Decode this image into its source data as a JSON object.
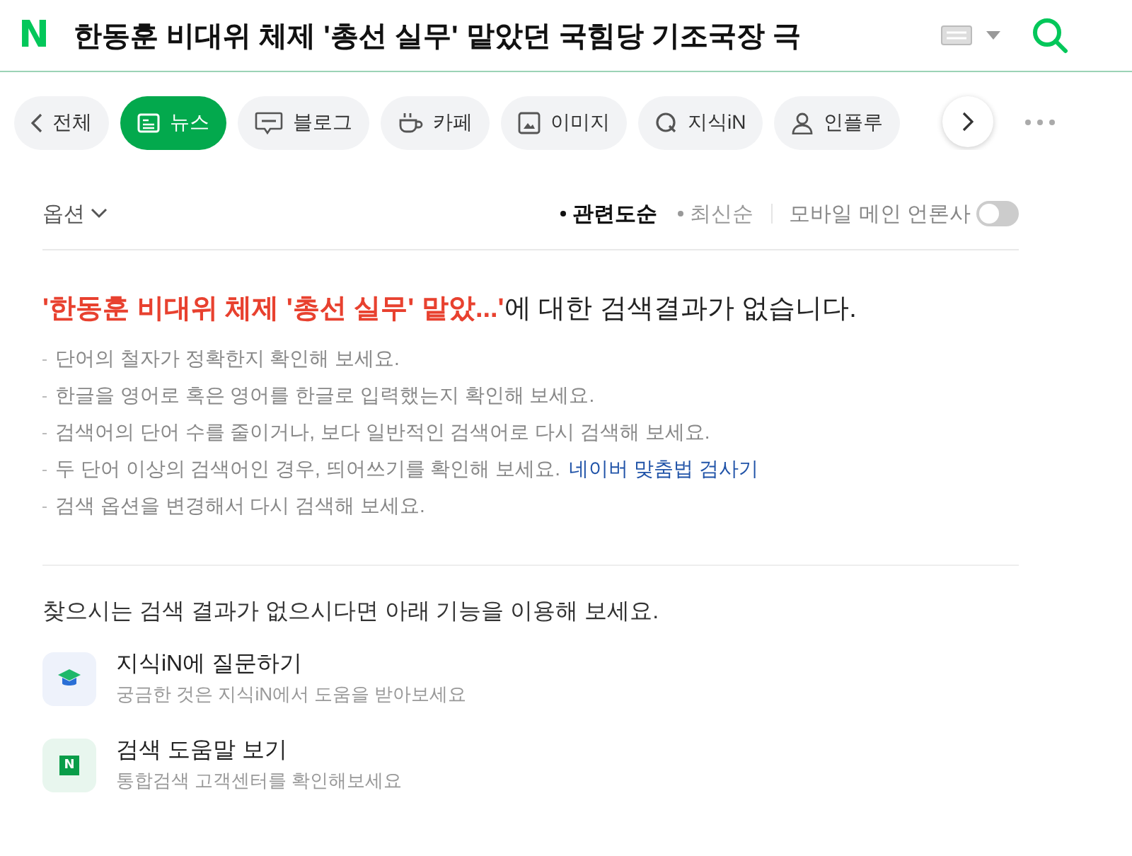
{
  "header": {
    "logo": "N",
    "query": "한동훈 비대위 체제 '총선 실무' 맡았던 국힘당 기조국장 극"
  },
  "tabs": [
    {
      "kind": "back",
      "label": "전체",
      "selected": false
    },
    {
      "kind": "news",
      "label": "뉴스",
      "selected": true
    },
    {
      "kind": "blog",
      "label": "블로그",
      "selected": false
    },
    {
      "kind": "cafe",
      "label": "카페",
      "selected": false
    },
    {
      "kind": "image",
      "label": "이미지",
      "selected": false
    },
    {
      "kind": "kin",
      "label": "지식iN",
      "selected": false
    },
    {
      "kind": "person",
      "label": "인플루",
      "selected": false
    }
  ],
  "options": {
    "label": "옵션",
    "sorts": [
      {
        "label": "관련도순",
        "selected": true
      },
      {
        "label": "최신순",
        "selected": false
      }
    ],
    "toggle_label": "모바일 메인 언론사",
    "toggle_on": false
  },
  "result": {
    "query": "'한동훈 비대위 체제 '총선 실무' 맡았...'",
    "message": "에 대한 검색결과가 없습니다.",
    "hints": [
      {
        "text": "단어의 철자가 정확한지 확인해 보세요."
      },
      {
        "text": "한글을 영어로 혹은 영어를 한글로 입력했는지 확인해 보세요."
      },
      {
        "text": "검색어의 단어 수를 줄이거나, 보다 일반적인 검색어로 다시 검색해 보세요."
      },
      {
        "text": "두 단어 이상의 검색어인 경우, 띄어쓰기를 확인해 보세요.",
        "link": "네이버 맞춤법 검사기"
      },
      {
        "text": "검색 옵션을 변경해서 다시 검색해 보세요."
      }
    ]
  },
  "help": {
    "title": "찾으시는 검색 결과가 없으시다면 아래 기능을 이용해 보세요.",
    "items": [
      {
        "kind": "kin",
        "title": "지식iN에 질문하기",
        "subtitle": "궁금한 것은 지식iN에서 도움을 받아보세요"
      },
      {
        "kind": "guide",
        "badge": "N",
        "title": "검색 도움말 보기",
        "subtitle": "통합검색 고객센터를 확인해보세요"
      }
    ]
  }
}
